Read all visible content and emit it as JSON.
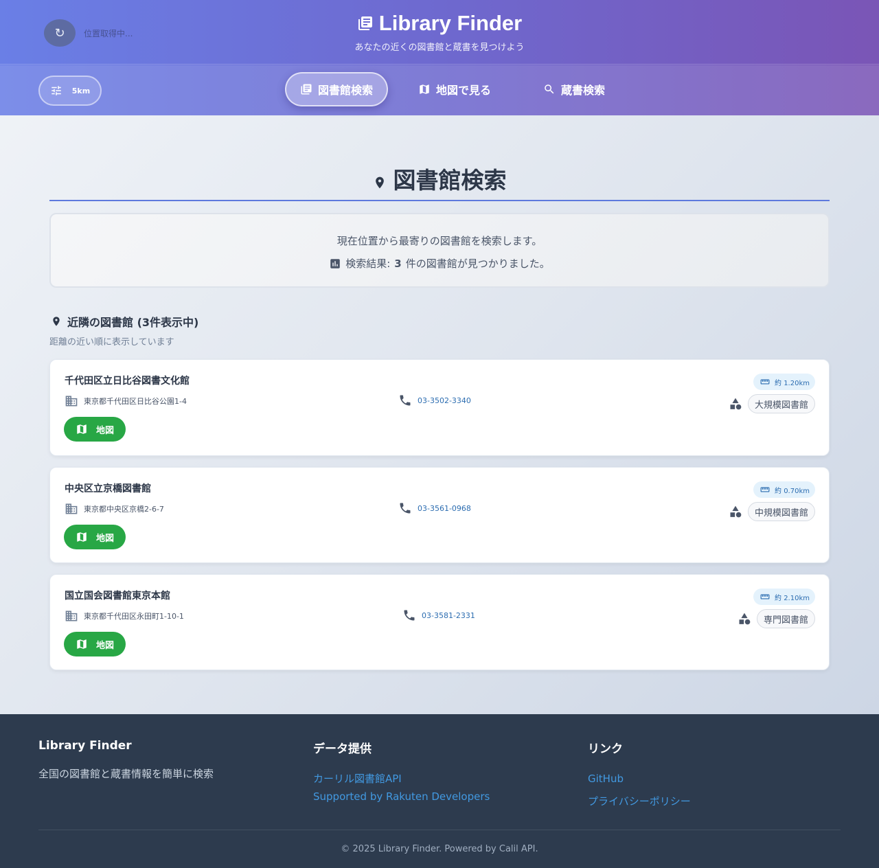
{
  "header": {
    "status_text": "位置取得中...",
    "title": "Library Finder",
    "subtitle": "あなたの近くの図書館と蔵書を見つけよう",
    "radius": "5km",
    "tabs": [
      {
        "label": "図書館検索",
        "icon": "library-icon",
        "active": true
      },
      {
        "label": "地図で見る",
        "icon": "map-icon",
        "active": false
      },
      {
        "label": "蔵書検索",
        "icon": "search-icon",
        "active": false
      }
    ]
  },
  "main": {
    "title": "図書館検索",
    "info_line1": "現在位置から最寄りの図書館を検索します。",
    "info_line2_prefix": "検索結果:",
    "info_count": "3",
    "info_line2_suffix": "件の図書館が見つかりました。",
    "section_title": "近隣の図書館 (3件表示中)",
    "section_subtitle": "距離の近い順に表示しています",
    "libraries": [
      {
        "name": "千代田区立日比谷図書文化館",
        "address": "東京都千代田区日比谷公園1-4",
        "phone": "03-3502-3340",
        "distance": "約 1.20km",
        "type": "大規模図書館",
        "map_label": "地図"
      },
      {
        "name": "中央区立京橋図書館",
        "address": "東京都中央区京橋2-6-7",
        "phone": "03-3561-0968",
        "distance": "約 0.70km",
        "type": "中規模図書館",
        "map_label": "地図"
      },
      {
        "name": "国立国会図書館東京本館",
        "address": "東京都千代田区永田町1-10-1",
        "phone": "03-3581-2331",
        "distance": "約 2.10km",
        "type": "専門図書館",
        "map_label": "地図"
      }
    ]
  },
  "footer": {
    "col1_title": "Library Finder",
    "col1_text": "全国の図書館と蔵書情報を簡単に検索",
    "col2_title": "データ提供",
    "col2_links": [
      "カーリル図書館API",
      "Supported by Rakuten Developers"
    ],
    "col3_title": "リンク",
    "col3_links": [
      "GitHub",
      "プライバシーポリシー"
    ],
    "copyright": "© 2025 Library Finder. Powered by Calil API."
  },
  "colors": {
    "header_start": "#6a7fe6",
    "header_end": "#7a55b6",
    "accent": "#5d79dd",
    "map_button": "#28a745",
    "link": "#2b6cb0",
    "footer_bg": "#2d3b4e"
  }
}
